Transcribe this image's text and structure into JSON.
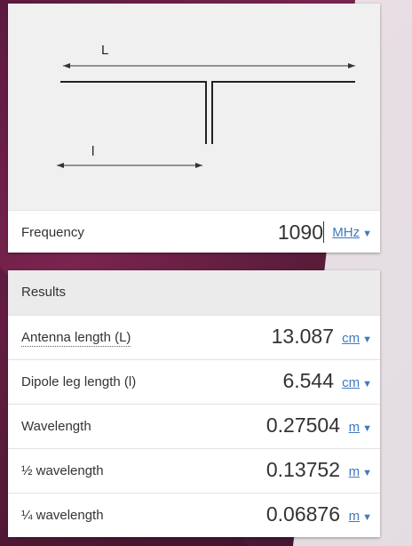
{
  "theme": {
    "accent": "#3d7bbf",
    "text": "#333333",
    "card_bg": "#f0f0f0",
    "header_bg": "#ebebeb"
  },
  "diagram": {
    "label_L": "L",
    "label_l": "l"
  },
  "frequency": {
    "label": "Frequency",
    "value": "1090",
    "unit": "MHz",
    "unit_arrow": "▼"
  },
  "results": {
    "title": "Results",
    "rows": [
      {
        "label": "Antenna length (L)",
        "value": "13.087",
        "unit": "cm",
        "arrow": "▼"
      },
      {
        "label": "Dipole leg length (l)",
        "value": "6.544",
        "unit": "cm",
        "arrow": "▼"
      },
      {
        "label": "Wavelength",
        "value": "0.27504",
        "unit": "m",
        "arrow": "▼"
      },
      {
        "label": "½ wavelength",
        "value": "0.13752",
        "unit": "m",
        "arrow": "▼"
      },
      {
        "label": "¼ wavelength",
        "value": "0.06876",
        "unit": "m",
        "arrow": "▼"
      }
    ]
  }
}
